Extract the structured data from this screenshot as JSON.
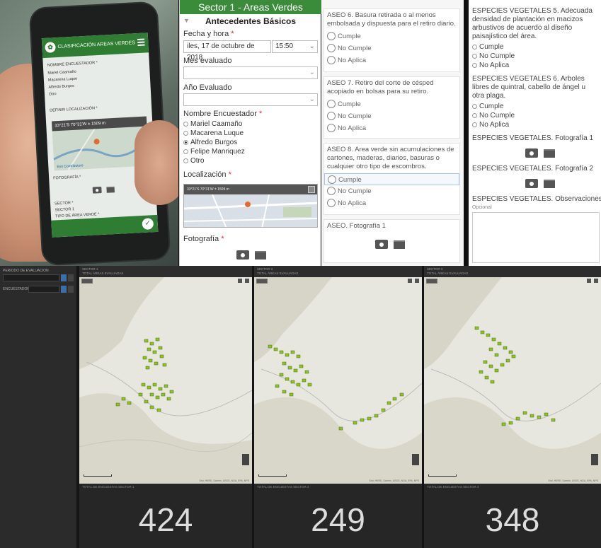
{
  "phone": {
    "app_title": "CLASIFICACIÓN AREAS VERDES",
    "lines": [
      "NOMBRE ENCUESTADOR *",
      "Mariel Caamaño",
      "Macarena Luque",
      "Alfredo Burgos",
      "Otro",
      "DEFINIR LOCALIZACIÓN *",
      "FOTOGRAFÍA *",
      "SECTOR *",
      "SECTOR 1",
      "TIPO DE ÁREA VERDE *"
    ],
    "coord_text": "33°21'S 70°31'W ± 1509 m",
    "map_link": "Esri Contributors"
  },
  "form1": {
    "title": "Sector 1 - Areas Verdes",
    "section": "Antecedentes Básicos",
    "fecha_label": "Fecha y hora",
    "fecha_value": "iles, 17 de octubre de 2018",
    "hora_value": "15:50",
    "mes_label": "Mes evaluado",
    "anio_label": "Año Evaluado",
    "encuestador_label": "Nombre Encuestador",
    "encuestadores": [
      "Mariel Caamaño",
      "Macarena Luque",
      "Alfredo Burgos",
      "Felipe Manriquez",
      "Otro"
    ],
    "encuestador_selected": 2,
    "loc_label": "Localización",
    "loc_coords": "33°21'S 70°31'W ± 1509 m",
    "foto_label": "Fotografía",
    "required_mark": "*"
  },
  "form2": {
    "q6": "ASEO 6. Basura retirada o al menos embolsada y dispuesta para el retiro diario.",
    "q7": "ASEO 7. Retiro del corte de césped acopiado en bolsas para su retiro.",
    "q8": "ASEO 8. Area verde sin acumulaciones de cartones, maderas, diarios, basuras o cualquier otro tipo de escombros.",
    "options": [
      "Cumple",
      "No Cumple",
      "No Aplica"
    ],
    "foto_label": "ASEO. Fotografía 1"
  },
  "form3": {
    "q5": "ESPECIES VEGETALES 5. Adecuada densidad de plantación en macizos arbustivos de acuerdo al diseño paisajístico del área.",
    "q6": "ESPECIES VEGETALES 6. Arboles libres de quintral, cabello de ángel u otra plaga.",
    "options": [
      "Cumple",
      "No Cumple",
      "No Aplica"
    ],
    "foto1": "ESPECIES VEGETALES. Fotografía 1",
    "foto2": "ESPECIES VEGETALES. Fotografía 2",
    "obs": "ESPECIES VEGETALES. Observaciones",
    "obs_hint": "Opcional"
  },
  "dashboard": {
    "side_title": "PERIODO DE EVALUACION",
    "side_field": "ENCUESTADOR",
    "maps": [
      {
        "title": "SECTOR 1",
        "subtitle": "TOTAL ÁREAS EVALUADAS",
        "count_title": "TOTAL DE ENCUESTAS SECTOR 1",
        "count": "424"
      },
      {
        "title": "SECTOR 2",
        "subtitle": "TOTAL ÁREAS EVALUADAS",
        "count_title": "TOTAL DE ENCUESTAS SECTOR 2",
        "count": "249"
      },
      {
        "title": "SECTOR 3",
        "subtitle": "TOTAL ÁREAS EVALUADAS",
        "count_title": "TOTAL DE ENCUESTAS SECTOR 3",
        "count": "348"
      }
    ],
    "map_attribution": "Esri, HERE, Garmin, USGS, NGA, EPA, NPS"
  },
  "colors": {
    "accent": "#3a8c3a",
    "marker": "#7cb518",
    "dark": "#2b2b2b"
  }
}
